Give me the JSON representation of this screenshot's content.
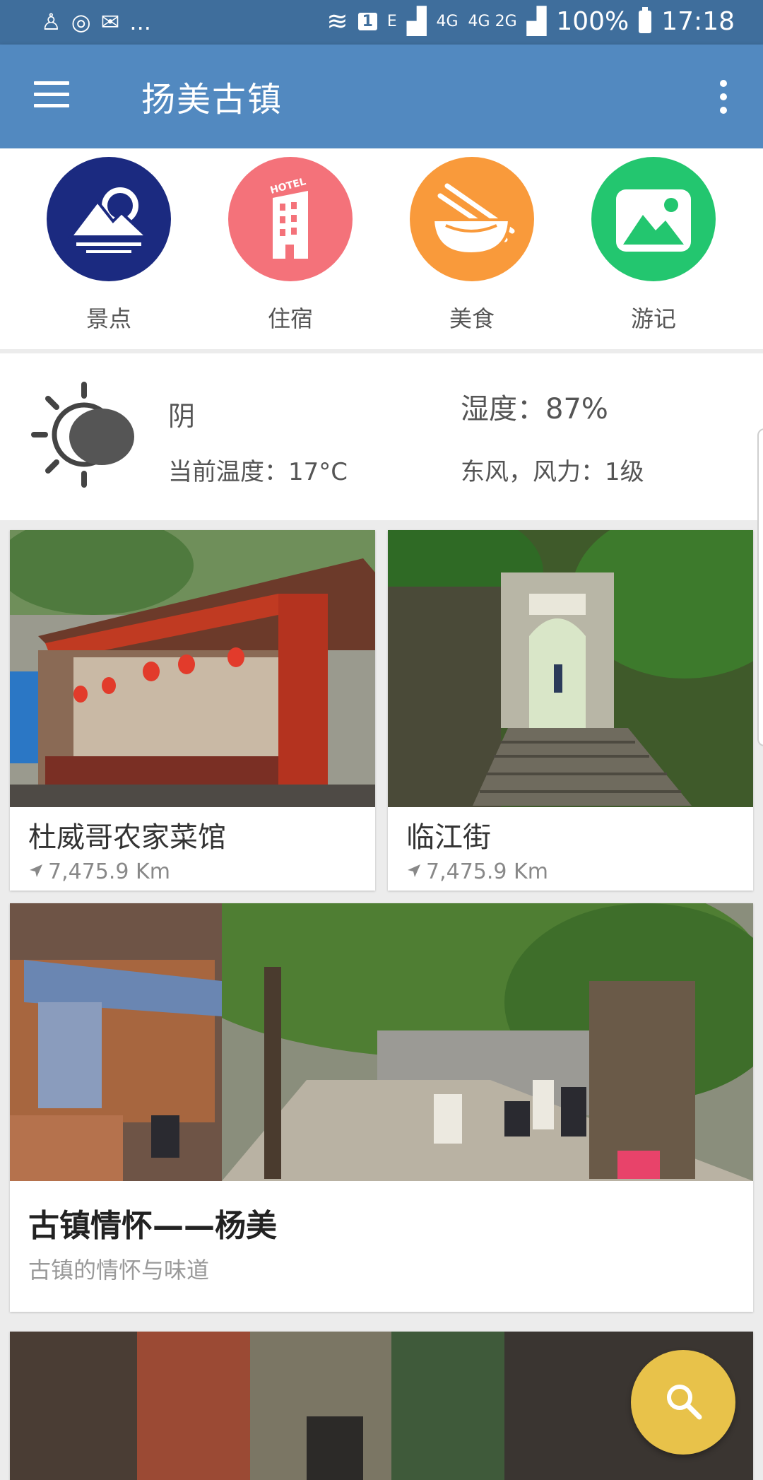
{
  "status_bar": {
    "left_icons": [
      "person-icon",
      "circle-icon",
      "wechat-icon"
    ],
    "ellipsis": "...",
    "sim_badge": "1",
    "net_e": "E",
    "net_4g": "4G",
    "net_4g2g": "4G 2G",
    "battery": "100%",
    "time": "17:18"
  },
  "app_bar": {
    "title": "扬美古镇",
    "menu_icon": "hamburger-menu-icon",
    "more_icon": "more-vert-icon"
  },
  "categories": [
    {
      "label": "景点",
      "icon": "mountain-sun-icon",
      "color": "#1b2a80"
    },
    {
      "label": "住宿",
      "icon": "hotel-building-icon",
      "color": "#f4727a"
    },
    {
      "label": "美食",
      "icon": "bowl-chopsticks-icon",
      "color": "#f99a3b"
    },
    {
      "label": "游记",
      "icon": "landscape-icon",
      "color": "#23c66f"
    }
  ],
  "weather": {
    "icon": "sun-cloud-icon",
    "condition": "阴",
    "humidity": "湿度：87%",
    "temperature": "当前温度：17°C",
    "wind": "东风，风力：1级"
  },
  "places": [
    {
      "title": "杜威哥农家菜馆",
      "distance": "7,475.9 Km"
    },
    {
      "title": "临江街",
      "distance": "7,475.9 Km"
    }
  ],
  "article": {
    "title": "古镇情怀——杨美",
    "subtitle": "古镇的情怀与味道"
  },
  "fab": {
    "icon": "search-icon"
  },
  "colors": {
    "status_bar": "#3f6e9c",
    "app_bar": "#5289c0",
    "fab": "#e8c24a"
  }
}
